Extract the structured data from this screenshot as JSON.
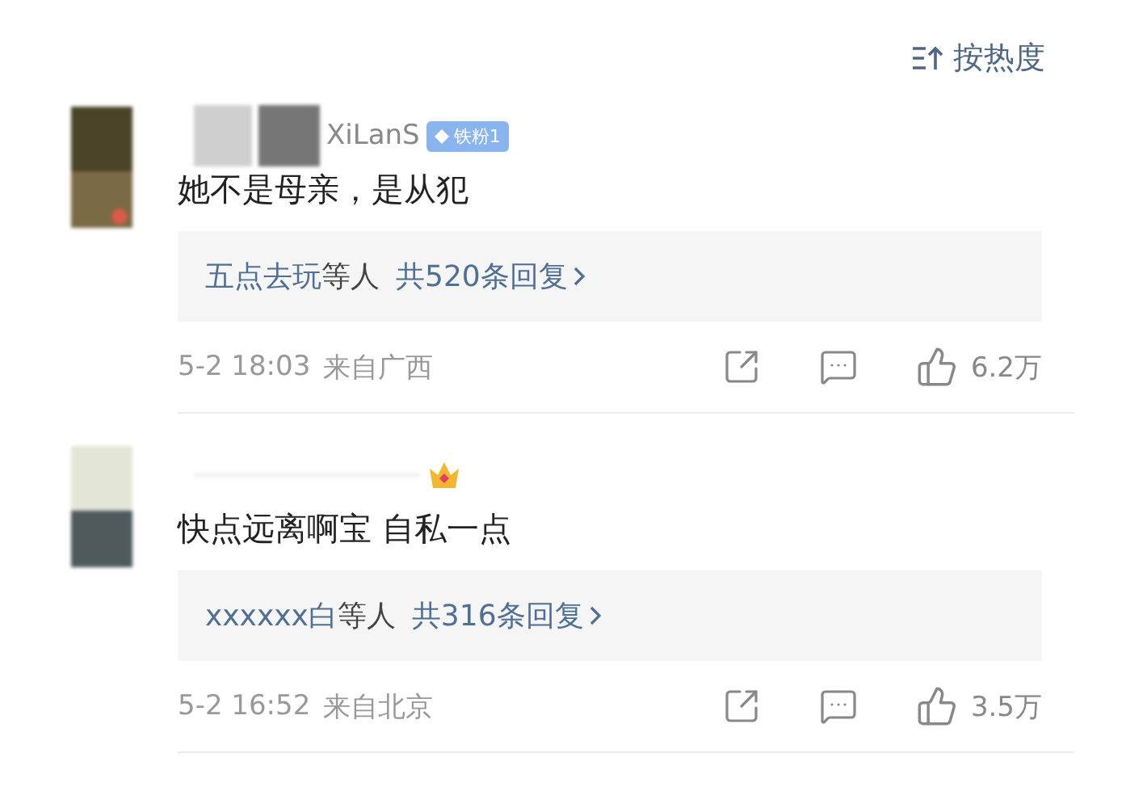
{
  "sort": {
    "label": "按热度"
  },
  "comments": [
    {
      "username": "XiLanS",
      "badge": {
        "kind": "fan",
        "label": "铁粉1"
      },
      "text": "她不是母亲，是从犯",
      "replies": {
        "users": "五点去玩",
        "suffix": "等人",
        "count": "共520条回复"
      },
      "time": "5-2 18:03",
      "location": "来自广西",
      "likes": "6.2万"
    },
    {
      "badge": {
        "kind": "crown"
      },
      "text": "快点远离啊宝 自私一点",
      "replies": {
        "users": "xxxxxx白",
        "suffix": "等人",
        "count": "共316条回复"
      },
      "time": "5-2 16:52",
      "location": "来自北京",
      "likes": "3.5万"
    }
  ]
}
